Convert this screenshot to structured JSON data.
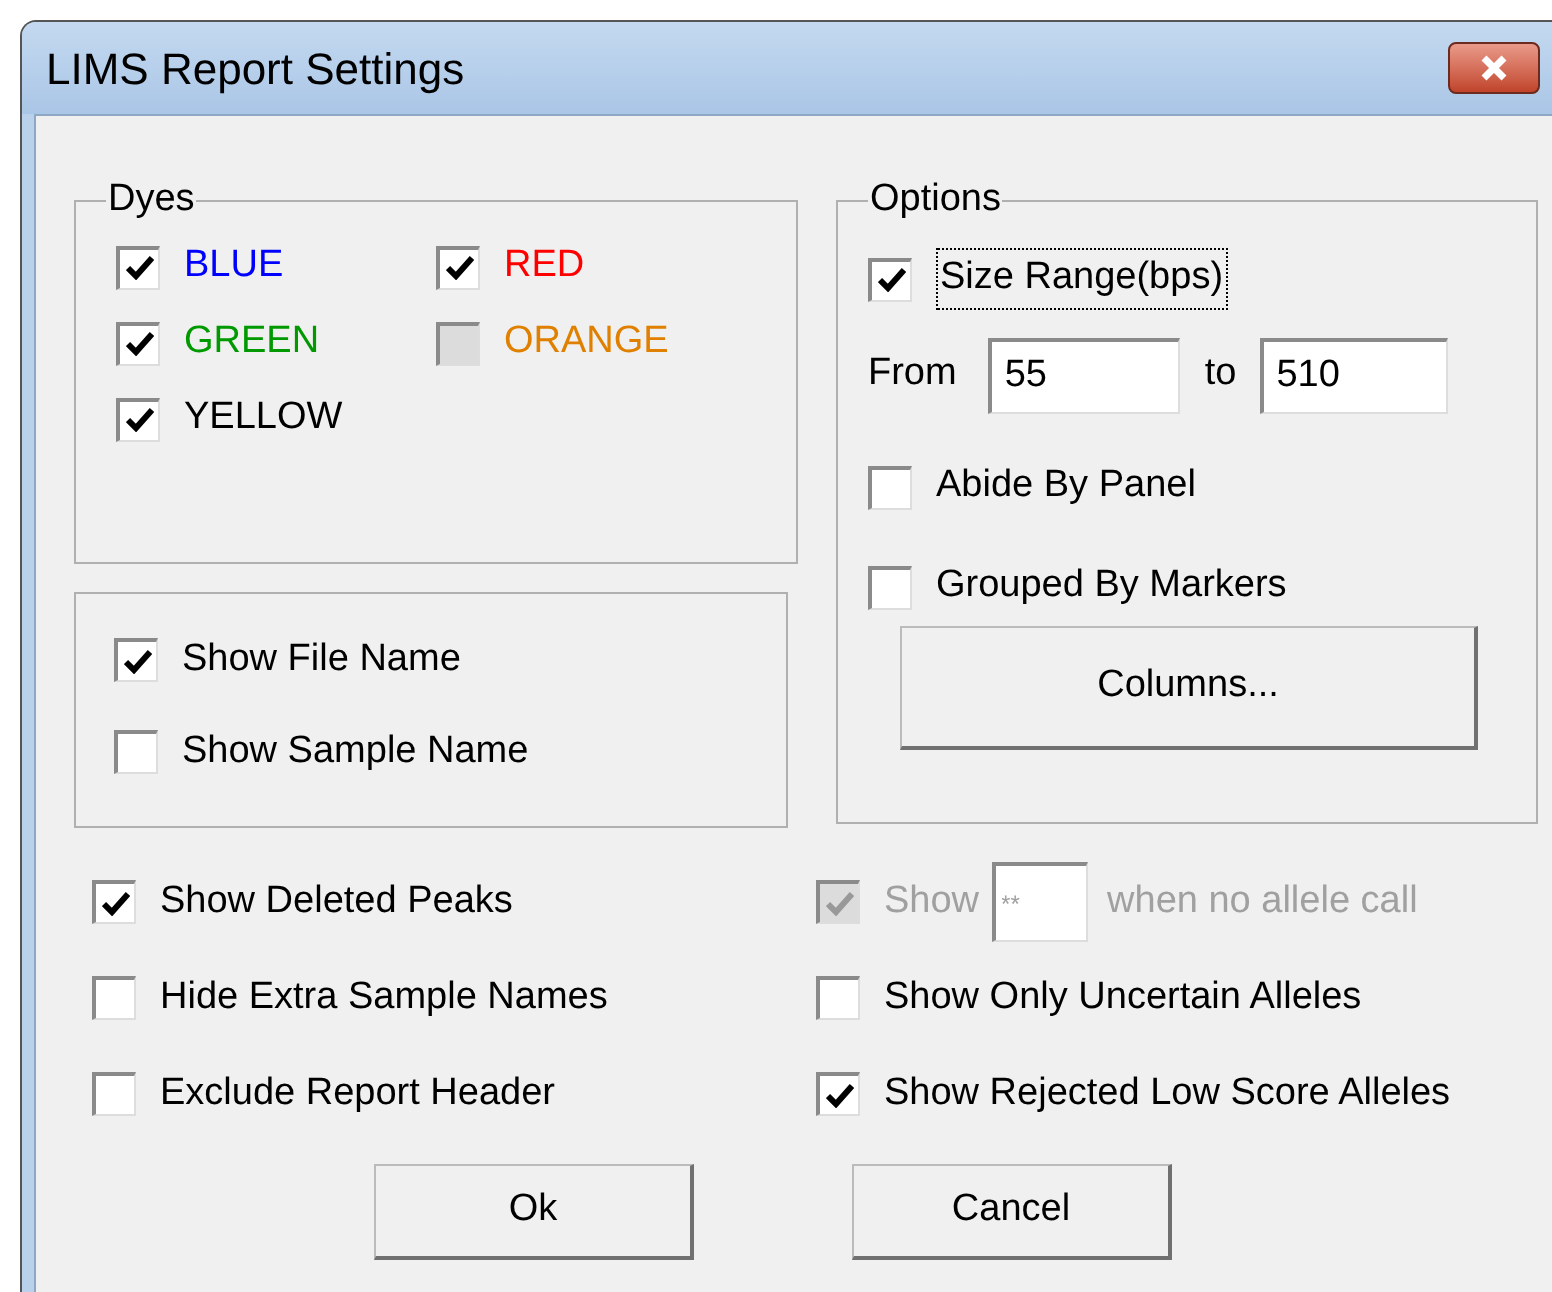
{
  "window": {
    "title": "LIMS Report Settings"
  },
  "dyes": {
    "label": "Dyes",
    "items": [
      {
        "label": "BLUE",
        "color": "#0000ff",
        "checked": true,
        "disabled": false
      },
      {
        "label": "RED",
        "color": "#ff0000",
        "checked": true,
        "disabled": false
      },
      {
        "label": "GREEN",
        "color": "#009900",
        "checked": true,
        "disabled": false
      },
      {
        "label": "ORANGE",
        "color": "#e08000",
        "checked": false,
        "disabled": true
      },
      {
        "label": "YELLOW",
        "color": "#000000",
        "checked": true,
        "disabled": false
      }
    ]
  },
  "name_options": [
    {
      "label": "Show File Name",
      "checked": true
    },
    {
      "label": "Show Sample Name",
      "checked": false
    }
  ],
  "options": {
    "label": "Options",
    "size_range": {
      "label": "Size Range(bps)",
      "checked": true
    },
    "from_label": "From",
    "from_value": "55",
    "to_label": "to",
    "to_value": "510",
    "checks": [
      {
        "label": "Abide By Panel",
        "checked": false
      },
      {
        "label": "Grouped By Markers",
        "checked": false
      }
    ],
    "columns_button": "Columns..."
  },
  "left_checks": [
    {
      "label": "Show Deleted Peaks",
      "checked": true
    },
    {
      "label": "Hide Extra Sample Names",
      "checked": false
    },
    {
      "label": "Exclude Report Header",
      "checked": false
    }
  ],
  "no_call": {
    "label": "Show",
    "value": "**",
    "suffix": "when no allele call",
    "checked": true,
    "disabled": true
  },
  "right_checks": [
    {
      "label": "Show Only Uncertain Alleles",
      "checked": false
    },
    {
      "label": "Show Rejected Low Score Alleles",
      "checked": true
    }
  ],
  "buttons": [
    "Ok",
    "Cancel"
  ]
}
